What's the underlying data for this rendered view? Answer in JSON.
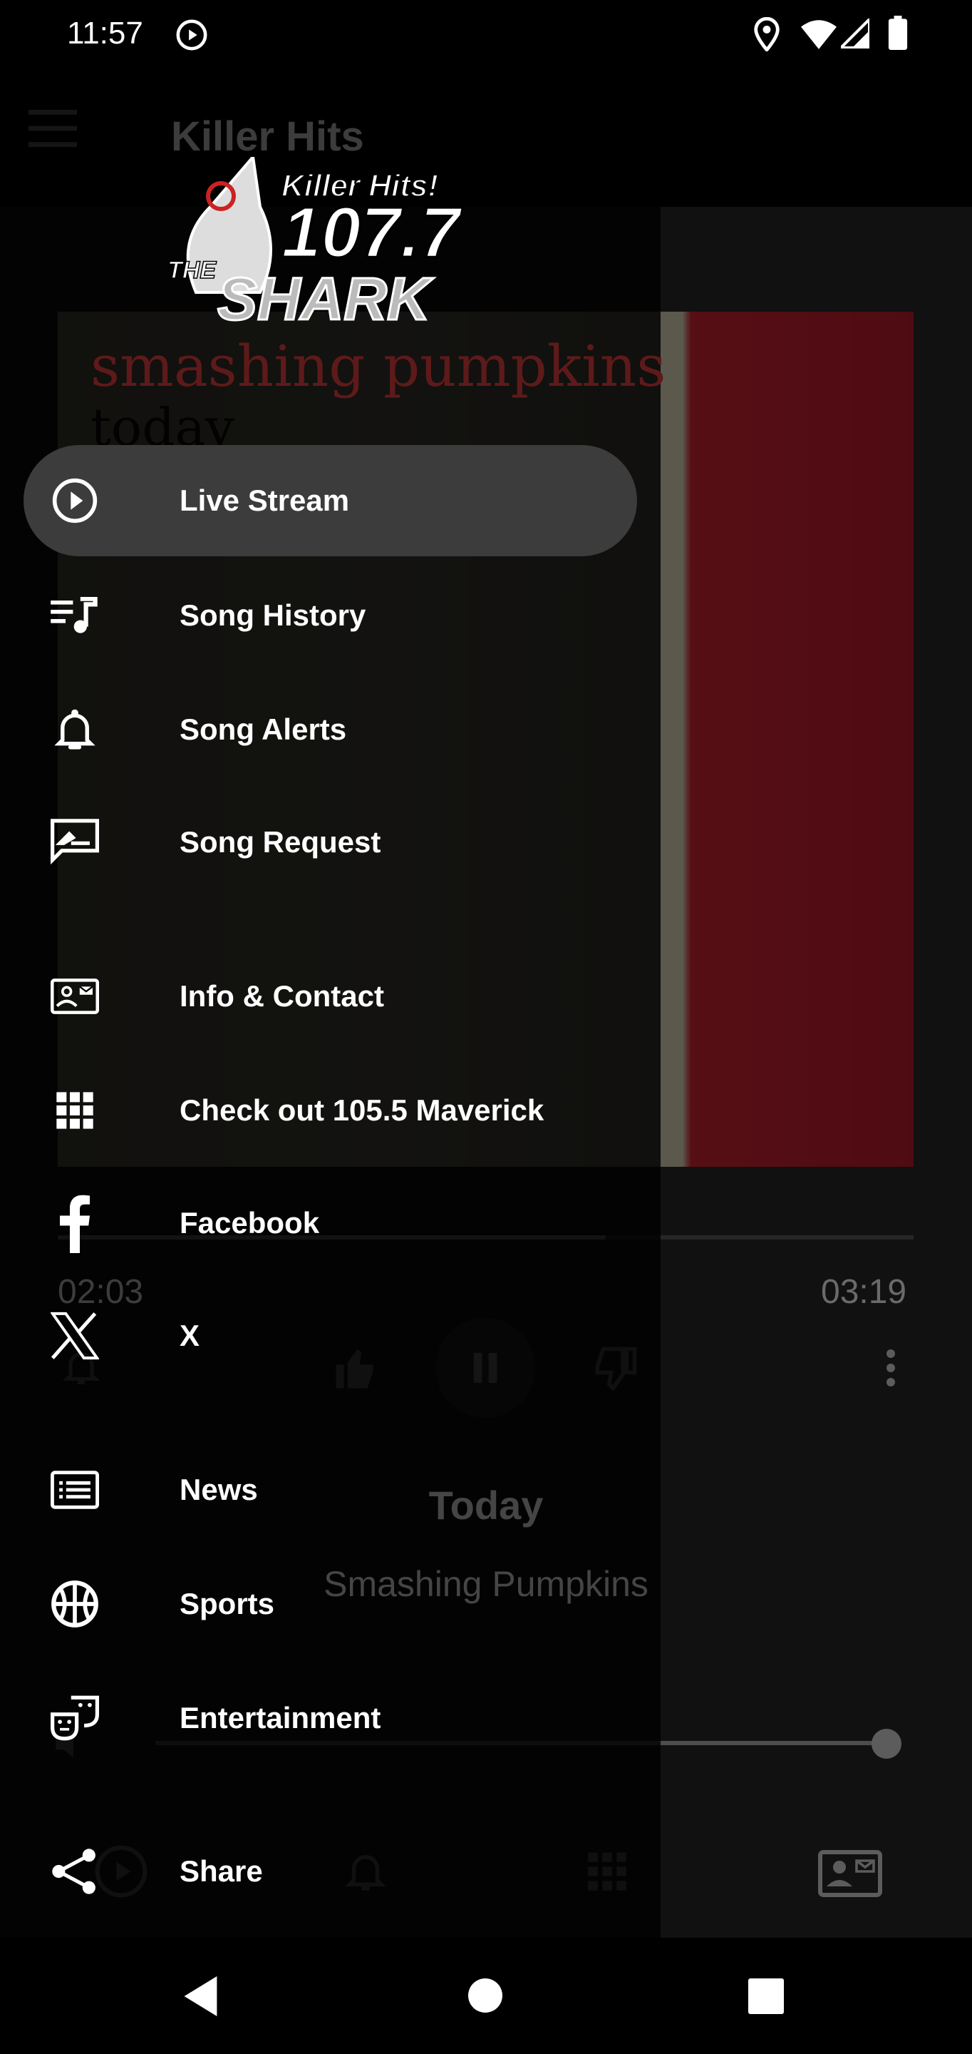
{
  "status_bar": {
    "time": "11:57",
    "icons": [
      "media-play-icon",
      "location-icon",
      "wifi-icon",
      "signal-icon",
      "battery-icon"
    ]
  },
  "app": {
    "title": "Killer Hits",
    "album_art_lettering": {
      "line1": "smashing pumpkins",
      "line2": "today"
    },
    "elapsed": "02:03",
    "duration": "03:19",
    "progress": 0.64,
    "song_title": "Today",
    "artist": "Smashing Pumpkins",
    "volume": 1.0
  },
  "drawer": {
    "logo_text": {
      "tagline": "Killer Hits!",
      "frequency": "107.7",
      "name": "THE SHARK"
    },
    "items": [
      {
        "label": "Live Stream",
        "icon": "play-circle-icon",
        "active": true
      },
      {
        "label": "Song History",
        "icon": "playlist-music-icon"
      },
      {
        "label": "Song Alerts",
        "icon": "bell-icon"
      },
      {
        "label": "Song Request",
        "icon": "rate-review-icon"
      },
      {
        "label": "Info & Contact",
        "icon": "contact-mail-icon"
      },
      {
        "label": "Check out 105.5 Maverick",
        "icon": "apps-grid-icon"
      },
      {
        "label": "Facebook",
        "icon": "facebook-icon"
      },
      {
        "label": "X",
        "icon": "x-logo-icon"
      },
      {
        "label": "News",
        "icon": "news-icon"
      },
      {
        "label": "Sports",
        "icon": "basketball-icon"
      },
      {
        "label": "Entertainment",
        "icon": "theater-masks-icon"
      },
      {
        "label": "Share",
        "icon": "share-icon"
      }
    ]
  },
  "colors": {
    "drawer_bg": "#000000",
    "active_item_bg": "#3c3c3c",
    "text": "#ffffff"
  }
}
